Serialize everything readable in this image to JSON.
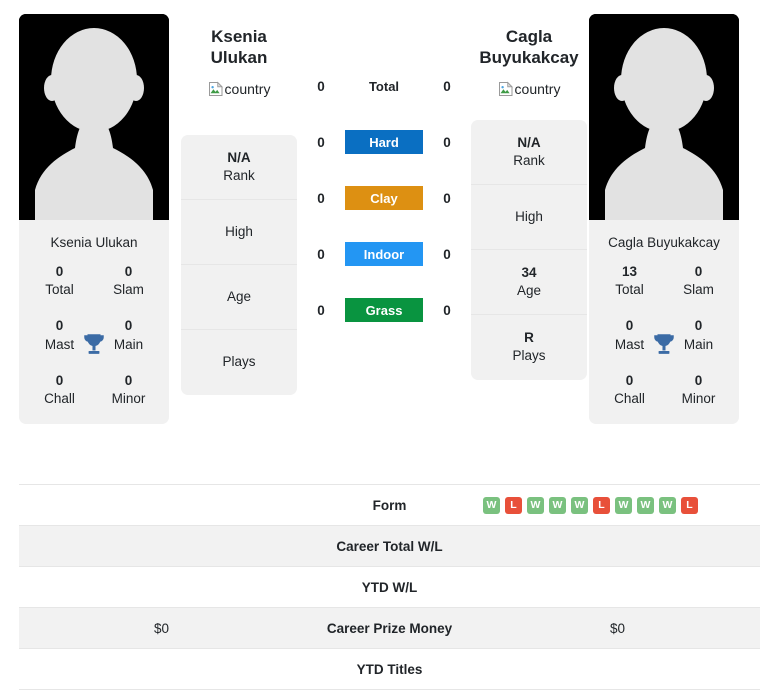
{
  "players": {
    "left": {
      "name_lines": [
        "Ksenia",
        "Ulukan"
      ],
      "photo_caption": "Ksenia Ulukan",
      "country_alt": "country",
      "info": [
        {
          "value": "N/A",
          "label": "Rank"
        },
        {
          "value": "",
          "label": "High"
        },
        {
          "value": "",
          "label": "Age"
        },
        {
          "value": "",
          "label": "Plays"
        }
      ],
      "titles": [
        {
          "value": "0",
          "label": "Total"
        },
        {
          "value": "0",
          "label": "Slam"
        },
        {
          "value": "0",
          "label": "Mast"
        },
        {
          "value": "0",
          "label": "Main"
        },
        {
          "value": "0",
          "label": "Chall"
        },
        {
          "value": "0",
          "label": "Minor"
        }
      ]
    },
    "right": {
      "name_lines": [
        "Cagla",
        "Buyukakcay"
      ],
      "photo_caption": "Cagla Buyukakcay",
      "country_alt": "country",
      "info": [
        {
          "value": "N/A",
          "label": "Rank"
        },
        {
          "value": "",
          "label": "High"
        },
        {
          "value": "34",
          "label": "Age"
        },
        {
          "value": "R",
          "label": "Plays"
        }
      ],
      "titles": [
        {
          "value": "13",
          "label": "Total"
        },
        {
          "value": "0",
          "label": "Slam"
        },
        {
          "value": "0",
          "label": "Mast"
        },
        {
          "value": "0",
          "label": "Main"
        },
        {
          "value": "0",
          "label": "Chall"
        },
        {
          "value": "0",
          "label": "Minor"
        }
      ]
    }
  },
  "surfaces": [
    {
      "label": "Total",
      "left": "0",
      "right": "0",
      "color": "transparent"
    },
    {
      "label": "Hard",
      "left": "0",
      "right": "0",
      "color": "#0a6fc2"
    },
    {
      "label": "Clay",
      "left": "0",
      "right": "0",
      "color": "#dd9012"
    },
    {
      "label": "Indoor",
      "left": "0",
      "right": "0",
      "color": "#2396f3"
    },
    {
      "label": "Grass",
      "left": "0",
      "right": "0",
      "color": "#099440"
    }
  ],
  "stats_rows": [
    {
      "label": "Form",
      "left": "",
      "right": ""
    },
    {
      "label": "Career Total W/L",
      "left": "",
      "right": ""
    },
    {
      "label": "YTD W/L",
      "left": "",
      "right": ""
    },
    {
      "label": "Career Prize Money",
      "left": "$0",
      "right": "$0"
    },
    {
      "label": "YTD Titles",
      "left": "",
      "right": ""
    }
  ],
  "form": {
    "right_results": [
      "W",
      "L",
      "W",
      "W",
      "W",
      "L",
      "W",
      "W",
      "W",
      "L"
    ],
    "win_color": "#7ac17f",
    "loss_color": "#e8503a"
  },
  "colors": {
    "card_bg": "#f1f1f1",
    "row_shade": "#f2f2f2",
    "trophy": "#3b6ba5"
  }
}
